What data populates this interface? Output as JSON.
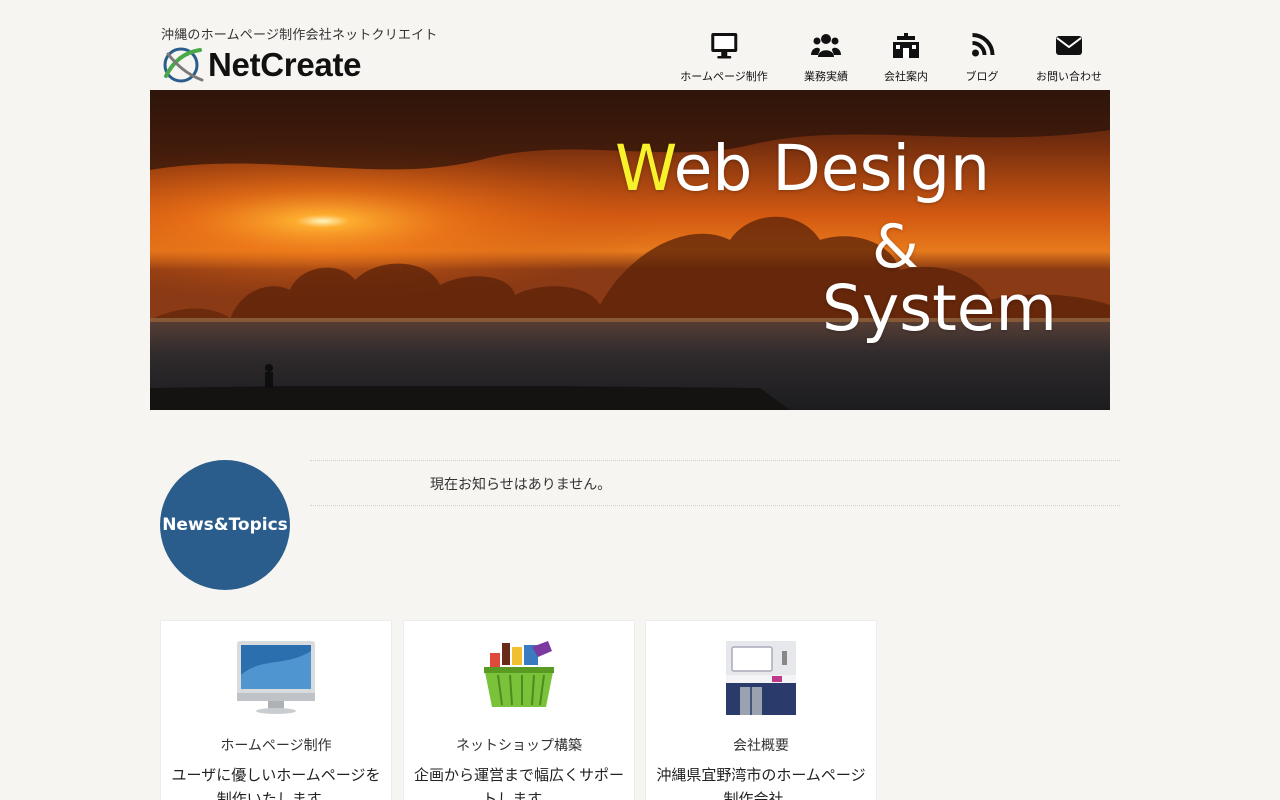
{
  "header": {
    "tagline": "沖縄のホームページ制作会社ネットクリエイト",
    "logo_text": "NetCreate"
  },
  "nav": [
    {
      "label": "ホームページ制作",
      "icon": "desktop-icon"
    },
    {
      "label": "業務実績",
      "icon": "users-icon"
    },
    {
      "label": "会社案内",
      "icon": "building-icon"
    },
    {
      "label": "ブログ",
      "icon": "rss-icon"
    },
    {
      "label": "お問い合わせ",
      "icon": "envelope-icon"
    }
  ],
  "hero": {
    "line1_accent": "W",
    "line1_rest": "eb Design",
    "line2": "&",
    "line3": "System"
  },
  "news": {
    "heading": "News&Topics",
    "message": "現在お知らせはありません。"
  },
  "cards": [
    {
      "title": "ホームページ制作",
      "desc": "ユーザに優しいホームページを制作いたします。",
      "icon": "imac-icon"
    },
    {
      "title": "ネットショップ構築",
      "desc": "企画から運営まで幅広くサポートします。",
      "icon": "shopping-basket-icon"
    },
    {
      "title": "会社概要",
      "desc": "沖縄県宜野湾市のホームページ制作会社。",
      "icon": "office-building-icon"
    }
  ],
  "colors": {
    "background": "#f7f5f1",
    "news_circle": "#2a5d8c",
    "hero_accent": "#f7f32b"
  }
}
